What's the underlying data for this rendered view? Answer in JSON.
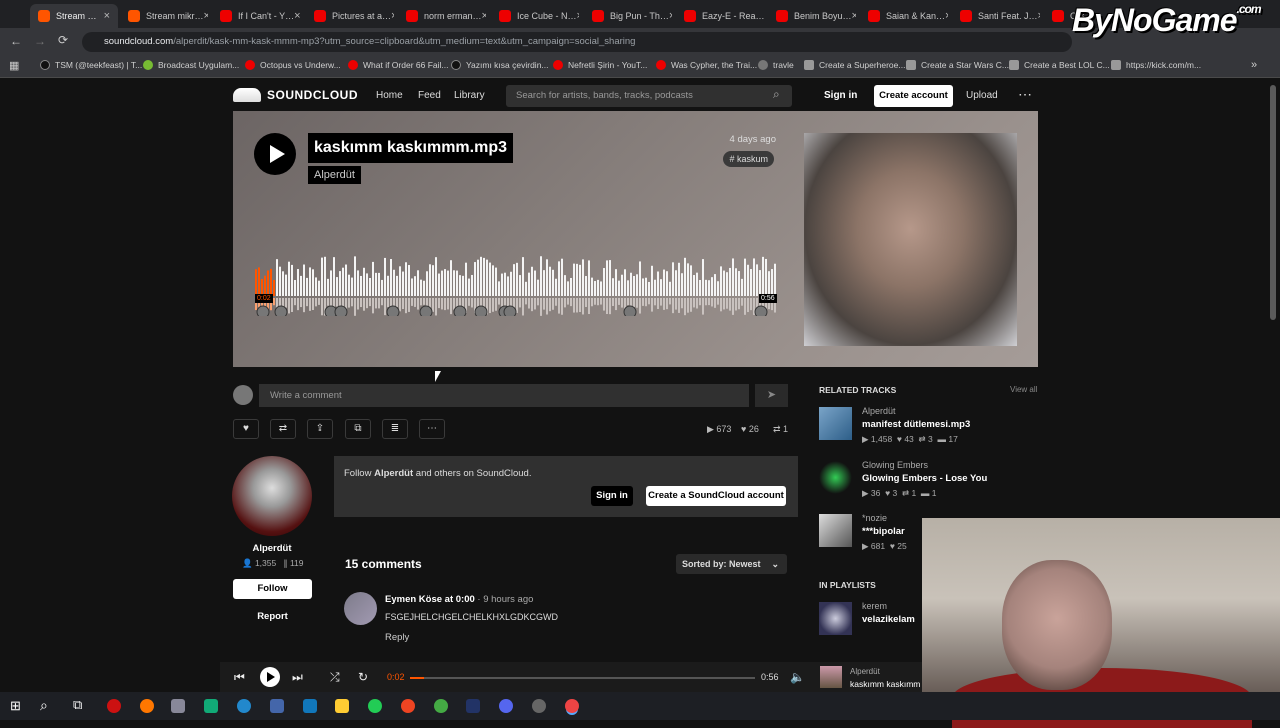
{
  "browser": {
    "tabs": [
      {
        "label": "Stream …",
        "active": true
      },
      {
        "label": "Stream mikr…"
      },
      {
        "label": "If I Can't - Y…"
      },
      {
        "label": "Pictures at a…"
      },
      {
        "label": "norm erman…"
      },
      {
        "label": "Ice Cube - N…"
      },
      {
        "label": "Big Pun - Th…"
      },
      {
        "label": "Eazy-E - Rea…"
      },
      {
        "label": "Benim Boyu…"
      },
      {
        "label": "Saian & Kan…"
      },
      {
        "label": "Santi Feat. J…"
      },
      {
        "label": "Cas…"
      }
    ],
    "url_domain": "soundcloud.com",
    "url_path": "/alperdit/kask-mm-kask-mmm-mp3?utm_source=clipboard&utm_medium=text&utm_campaign=social_sharing",
    "bookmarks": [
      "TSM (@teekfeast) | T...",
      "Broadcast Uygulam...",
      "Octopus vs Underw...",
      "What if Order 66 Fail...",
      "Yazımı kısa çevirdin...",
      "Nefretli Şirin - YouT...",
      "Was Cypher, the Trai...",
      "travle",
      "Create a Superheroe...",
      "Create a Star Wars C...",
      "Create a Best LOL C...",
      "https://kick.com/m..."
    ]
  },
  "header": {
    "logo": "SOUNDCLOUD",
    "nav": [
      "Home",
      "Feed",
      "Library"
    ],
    "search_placeholder": "Search for artists, bands, tracks, podcasts",
    "sign_in": "Sign in",
    "create_account": "Create account",
    "upload": "Upload"
  },
  "track": {
    "title": "kaskımm kaskımmm.mp3",
    "artist": "Alperdüt",
    "posted": "4 days ago",
    "tag": "# kaskum",
    "elapsed": "0:02",
    "duration": "0:56",
    "progress": 0.04
  },
  "comment_box": {
    "placeholder": "Write a comment"
  },
  "stats": {
    "plays": "673",
    "likes": "26",
    "reposts": "1"
  },
  "artist_panel": {
    "name": "Alperdüt",
    "followers": "1,355",
    "tracks": "119",
    "follow": "Follow",
    "report": "Report"
  },
  "follow_box": {
    "text_pre": "Follow ",
    "text_name": "Alperdüt",
    "text_post": " and others on SoundCloud.",
    "sign_in": "Sign in",
    "create": "Create a SoundCloud account"
  },
  "comments": {
    "count_label": "15 comments",
    "sort_label": "Sorted by: Newest",
    "items": [
      {
        "user": "Eymen Köse",
        "at": "at 0:00",
        "ago": "· 9 hours ago",
        "body": "FSGEJHELCHGELCHELKHXLGDKCGWD",
        "reply": "Reply"
      }
    ]
  },
  "related": {
    "title": "RELATED TRACKS",
    "view_all": "View all",
    "items": [
      {
        "user": "Alperdüt",
        "title": "manifest dütlemesi.mp3",
        "plays": "1,458",
        "likes": "43",
        "reposts": "3",
        "comments": "17"
      },
      {
        "user": "Glowing Embers",
        "title": "Glowing Embers - Lose You",
        "plays": "36",
        "likes": "3",
        "reposts": "1",
        "comments": "1"
      },
      {
        "user": "*nozie",
        "title": "***bipolar",
        "plays": "681",
        "likes": "25",
        "reposts": "",
        "comments": ""
      }
    ]
  },
  "playlists": {
    "title": "IN PLAYLISTS",
    "items": [
      {
        "user": "kerem",
        "title": "velazikelam"
      }
    ]
  },
  "player": {
    "elapsed": "0:02",
    "duration": "0:56",
    "progress": 0.04,
    "artist": "Alperdüt",
    "track": "kaskımm kaskımm"
  },
  "watermark": "ByNoGame",
  "watermark_suffix": ".com",
  "colors": {
    "accent": "#ff5500",
    "background": "#121212"
  }
}
